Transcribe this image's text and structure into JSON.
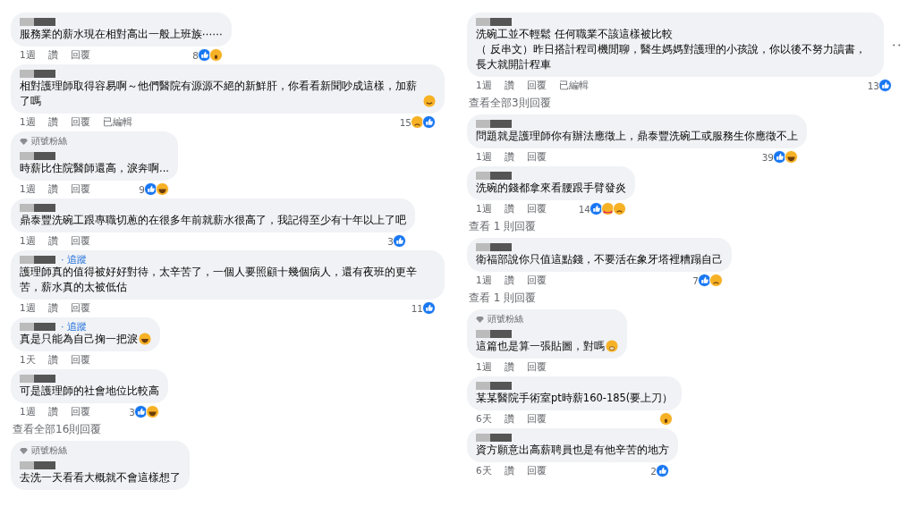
{
  "columns": [
    {
      "items": [
        {
          "kind": "comment",
          "text": [
            "服務業的薪水現在相對高出一般上班族⋯⋯"
          ],
          "time": "1週",
          "like": "讚",
          "reply": "回覆",
          "count": "8",
          "reactions": [
            {
              "kind": "like"
            },
            {
              "kind": "wow"
            }
          ]
        },
        {
          "kind": "comment",
          "text": [
            "相對護理師取得容易啊～他們醫院有源源不絕的新鮮肝，你看看新聞吵成這樣，加薪了嗎"
          ],
          "emoji": {
            "kind": "grin"
          },
          "time": "1週",
          "like": "讚",
          "reply": "回覆",
          "edited": "已編輯",
          "count": "15",
          "reactions": [
            {
              "kind": "sad"
            },
            {
              "kind": "like"
            }
          ]
        },
        {
          "kind": "comment",
          "badge": "頭號粉絲",
          "text": [
            "時薪比住院醫師還高，淚奔啊..."
          ],
          "time": "1週",
          "like": "讚",
          "reply": "回覆",
          "count": "9",
          "reactions": [
            {
              "kind": "like"
            },
            {
              "kind": "haha"
            }
          ]
        },
        {
          "kind": "comment",
          "text": [
            "鼎泰豐洗碗工跟專職切蔥的在很多年前就薪水很高了，我記得至少有十年以上了吧"
          ],
          "time": "1週",
          "like": "讚",
          "reply": "回覆",
          "count": "3",
          "reactions": [
            {
              "kind": "like"
            }
          ]
        },
        {
          "kind": "comment",
          "follow": "· 追蹤",
          "text": [
            "護理師真的值得被好好對待，太辛苦了，一個人要照顧十幾個病人，還有夜班的更辛苦，薪水真的太被低估"
          ],
          "time": "1週",
          "like": "讚",
          "reply": "回覆",
          "count": "11",
          "reactions": [
            {
              "kind": "like"
            }
          ]
        },
        {
          "kind": "comment",
          "follow": "· 追蹤",
          "text": [
            "真是只能為自己掬一把淚"
          ],
          "emoji": {
            "kind": "haha"
          },
          "time": "1天",
          "like": "讚",
          "reply": "回覆"
        },
        {
          "kind": "comment",
          "text": [
            "可是護理師的社會地位比較高"
          ],
          "time": "1週",
          "like": "讚",
          "reply": "回覆",
          "count": "3",
          "reactions": [
            {
              "kind": "like"
            },
            {
              "kind": "haha"
            }
          ]
        },
        {
          "kind": "more",
          "label": "查看全部16則回覆"
        },
        {
          "kind": "comment",
          "badge": "頭號粉絲",
          "text": [
            "去洗一天看看大概就不會這樣想了"
          ]
        }
      ]
    },
    {
      "items": [
        {
          "kind": "comment",
          "text": [
            "洗碗工並不輕鬆 任何職業不該這樣被比較",
            "（ 反串文）昨日搭計程司機閒聊，醫生媽媽對護理的小孩說，你以後不努力讀書，長大就開計程車"
          ],
          "time": "1週",
          "like": "讚",
          "reply": "回覆",
          "edited": "已編輯",
          "count": "13",
          "reactions": [
            {
              "kind": "like"
            }
          ],
          "menu": true
        },
        {
          "kind": "more",
          "label": "查看全部3則回覆"
        },
        {
          "kind": "comment",
          "text": [
            "問題就是護理師你有辦法應徵上，鼎泰豐洗碗工或服務生你應徵不上"
          ],
          "time": "1週",
          "like": "讚",
          "reply": "回覆",
          "count": "39",
          "reactions": [
            {
              "kind": "like"
            },
            {
              "kind": "haha"
            }
          ]
        },
        {
          "kind": "comment",
          "text": [
            "洗碗的錢都拿來看腰跟手臂發炎"
          ],
          "time": "1週",
          "like": "讚",
          "reply": "回覆",
          "count": "14",
          "reactions": [
            {
              "kind": "like"
            },
            {
              "kind": "care"
            },
            {
              "kind": "sad"
            }
          ]
        },
        {
          "kind": "more",
          "label": "查看 1 則回覆"
        },
        {
          "kind": "comment",
          "text": [
            "衛福部說你只值這點錢，不要活在象牙塔裡糟蹋自己"
          ],
          "time": "1週",
          "like": "讚",
          "reply": "回覆",
          "count": "7",
          "reactions": [
            {
              "kind": "like"
            },
            {
              "kind": "sad"
            }
          ]
        },
        {
          "kind": "more",
          "label": "查看 1 則回覆"
        },
        {
          "kind": "comment",
          "badge": "頭號粉絲",
          "text": [
            "這篇也是算一張貼圖，對嗎"
          ],
          "emoji": {
            "kind": "hush"
          },
          "time": "1週",
          "like": "讚",
          "reply": "回覆"
        },
        {
          "kind": "comment",
          "text": [
            "某某醫院手術室pt時薪160-185(要上刀）"
          ],
          "time": "6天",
          "like": "讚",
          "reply": "回覆",
          "reactions": [
            {
              "kind": "wow"
            }
          ]
        },
        {
          "kind": "comment",
          "text": [
            "資方願意出高薪聘員也是有他辛苦的地方"
          ],
          "time": "6天",
          "like": "讚",
          "reply": "回覆",
          "count": "2",
          "reactions": [
            {
              "kind": "like"
            }
          ]
        }
      ]
    }
  ]
}
